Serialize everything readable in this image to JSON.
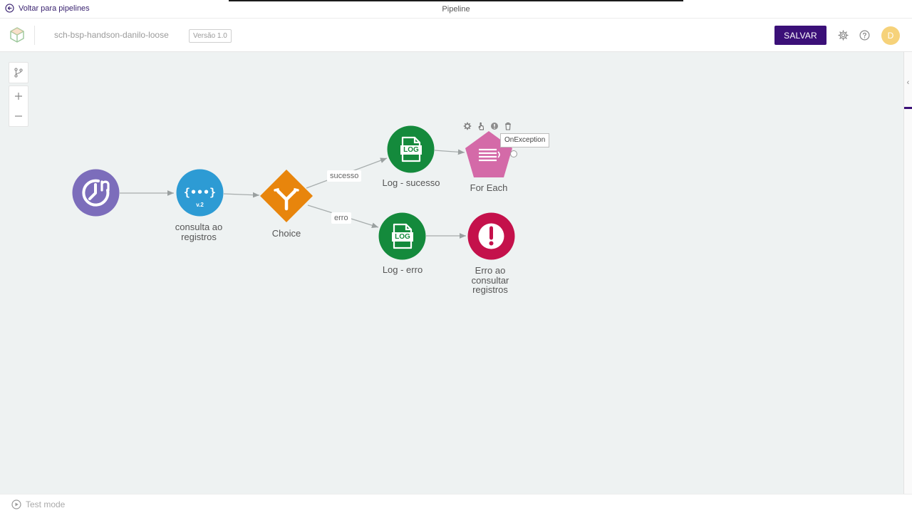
{
  "topbar": {
    "back_label": "Voltar para pipelines",
    "title": "Pipeline"
  },
  "header": {
    "pipeline_name": "sch-bsp-handson-danilo-loose",
    "version": "Versão 1.0",
    "save_label": "SALVAR",
    "avatar_initial": "D"
  },
  "canvas": {
    "nodes": {
      "trigger": {
        "label": ""
      },
      "consulta": {
        "label_line1": "consulta ao",
        "label_line2": "registros",
        "badge": "v.2"
      },
      "choice": {
        "label": "Choice"
      },
      "log_sucesso": {
        "label": "Log - sucesso",
        "icon_text": "LOG"
      },
      "for_each": {
        "label": "For Each"
      },
      "log_erro": {
        "label": "Log - erro",
        "icon_text": "LOG"
      },
      "erro": {
        "label_line1": "Erro ao",
        "label_line2": "consultar",
        "label_line3": "registros"
      }
    },
    "edges": {
      "sucesso": "sucesso",
      "erro": "erro"
    },
    "tooltip": "OnException"
  },
  "footer": {
    "test_mode_label": "Test mode"
  },
  "colors": {
    "brand": "#3b1078",
    "trigger": "#7c6dbb",
    "script": "#2d9bd4",
    "choice": "#e8850c",
    "log": "#148a3c",
    "for_each": "#d46aa8",
    "error": "#c4114b"
  }
}
